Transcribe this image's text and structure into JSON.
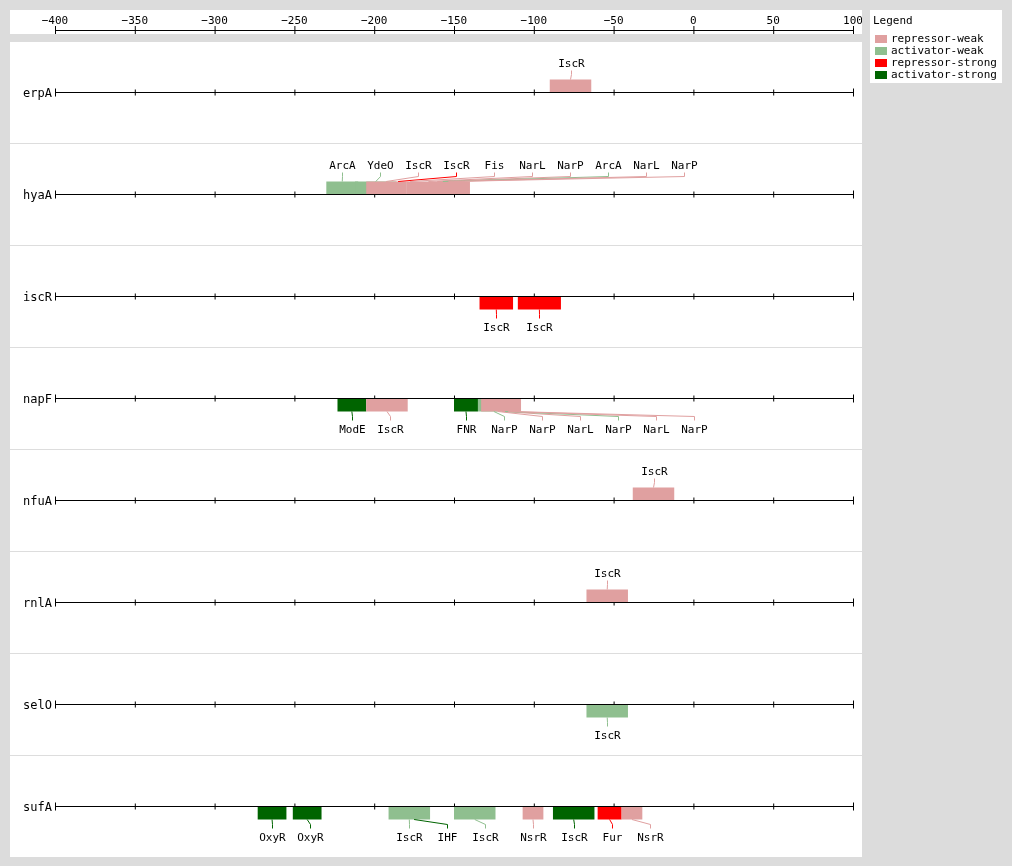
{
  "axis": {
    "ticks": [
      {
        "label": "−400"
      },
      {
        "label": "−350"
      },
      {
        "label": "−300"
      },
      {
        "label": "−250"
      },
      {
        "label": "−200"
      },
      {
        "label": "−150"
      },
      {
        "label": "−100"
      },
      {
        "label": "−50"
      },
      {
        "label": "0"
      },
      {
        "label": "50"
      },
      {
        "label": "100"
      }
    ]
  },
  "legend": {
    "title": "Legend",
    "items": [
      {
        "kind": "repressor_weak",
        "label": "repressor-weak",
        "color": "#e0a0a0"
      },
      {
        "kind": "activator_weak",
        "label": "activator-weak",
        "color": "#8fbf8f"
      },
      {
        "kind": "repressor_strong",
        "label": "repressor-strong",
        "color": "#ff0000"
      },
      {
        "kind": "activator_strong",
        "label": "activator-strong",
        "color": "#006400"
      }
    ]
  },
  "genes": [
    {
      "name": "erpA",
      "sites": [
        {
          "name": "IscR",
          "kind": "repressor_weak"
        }
      ]
    },
    {
      "name": "hyaA",
      "sites": [
        {
          "name": "ArcA",
          "kind": "activator_weak"
        },
        {
          "name": "YdeO",
          "kind": "activator_weak"
        },
        {
          "name": "IscR",
          "kind": "repressor_weak"
        },
        {
          "name": "IscR",
          "kind": "repressor_strong"
        },
        {
          "name": "Fis",
          "kind": "repressor_weak"
        },
        {
          "name": "NarL",
          "kind": "repressor_weak"
        },
        {
          "name": "NarP",
          "kind": "repressor_weak"
        },
        {
          "name": "ArcA",
          "kind": "activator_weak"
        },
        {
          "name": "NarL",
          "kind": "repressor_weak"
        },
        {
          "name": "NarP",
          "kind": "repressor_weak"
        }
      ]
    },
    {
      "name": "iscR",
      "sites": [
        {
          "name": "IscR",
          "kind": "repressor_strong"
        },
        {
          "name": "IscR",
          "kind": "repressor_strong"
        }
      ]
    },
    {
      "name": "napF",
      "sites": [
        {
          "name": "ModE",
          "kind": "activator_strong"
        },
        {
          "name": "IscR",
          "kind": "repressor_weak"
        },
        {
          "name": "FNR",
          "kind": "activator_strong"
        },
        {
          "name": "NarP",
          "kind": "activator_weak"
        },
        {
          "name": "NarP",
          "kind": "repressor_weak"
        },
        {
          "name": "NarL",
          "kind": "repressor_weak"
        },
        {
          "name": "NarP",
          "kind": "activator_weak"
        },
        {
          "name": "NarL",
          "kind": "repressor_weak"
        },
        {
          "name": "NarP",
          "kind": "repressor_weak"
        }
      ]
    },
    {
      "name": "nfuA",
      "sites": [
        {
          "name": "IscR",
          "kind": "repressor_weak"
        }
      ]
    },
    {
      "name": "rnlA",
      "sites": [
        {
          "name": "IscR",
          "kind": "repressor_weak"
        }
      ]
    },
    {
      "name": "selO",
      "sites": [
        {
          "name": "IscR",
          "kind": "activator_weak"
        }
      ]
    },
    {
      "name": "sufA",
      "sites": [
        {
          "name": "OxyR",
          "kind": "activator_strong"
        },
        {
          "name": "OxyR",
          "kind": "activator_strong"
        },
        {
          "name": "IscR",
          "kind": "activator_weak"
        },
        {
          "name": "IHF",
          "kind": "activator_strong"
        },
        {
          "name": "IscR",
          "kind": "activator_weak"
        },
        {
          "name": "NsrR",
          "kind": "repressor_weak"
        },
        {
          "name": "IscR",
          "kind": "activator_strong"
        },
        {
          "name": "Fur",
          "kind": "repressor_strong"
        },
        {
          "name": "NsrR",
          "kind": "repressor_weak"
        }
      ]
    }
  ]
}
